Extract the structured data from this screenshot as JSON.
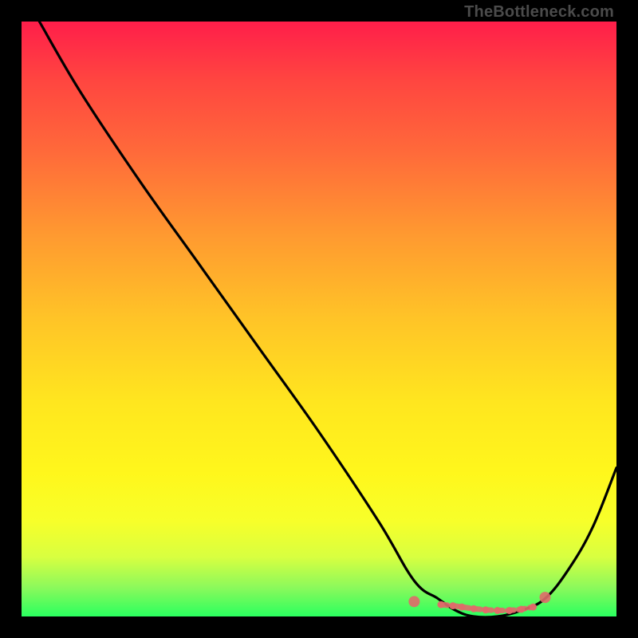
{
  "attribution": "TheBottleneck.com",
  "chart_data": {
    "type": "line",
    "title": "",
    "xlabel": "",
    "ylabel": "",
    "xlim": [
      0,
      100
    ],
    "ylim": [
      0,
      100
    ],
    "series": [
      {
        "name": "bottleneck-curve",
        "x": [
          3,
          10,
          20,
          30,
          40,
          50,
          60,
          66,
          70,
          73,
          76,
          80,
          84,
          88,
          92,
          96,
          100
        ],
        "y": [
          100,
          88,
          73,
          59,
          45,
          31,
          16,
          6,
          3,
          1,
          0,
          0,
          1,
          3,
          8,
          15,
          25
        ]
      }
    ],
    "markers": {
      "name": "highlight-cluster",
      "color": "#e06a6a",
      "x": [
        66,
        70.5,
        72.5,
        74,
        76,
        78,
        80,
        82,
        84,
        86,
        88
      ],
      "y": [
        2.5,
        2,
        1.8,
        1.6,
        1.3,
        1.1,
        1,
        1,
        1.2,
        1.6,
        3.2
      ]
    },
    "background": "rainbow-gradient",
    "curve_color": "#000000"
  }
}
